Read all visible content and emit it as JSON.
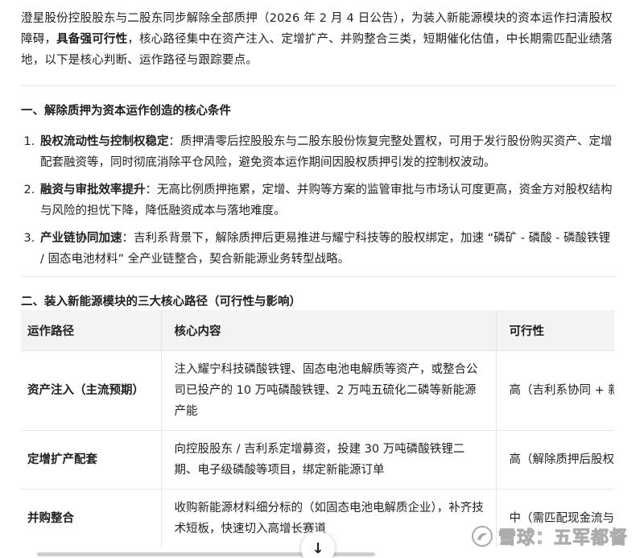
{
  "intro": {
    "text_a": "澄星股份控股股东与二股东同步解除全部质押（2026 年 2 月 4 日公告），为装入新能源模块的资本运作扫清股权障碍，",
    "bold": "具备强可行性",
    "text_b": "，核心路径集中在资产注入、定增扩产、并购整合三类，短期催化估值，中长期需匹配业绩落地，以下是核心判断、运作路径与跟踪要点。"
  },
  "section1": {
    "title": "一、解除质押为资本运作创造的核心条件",
    "items": [
      {
        "bold": "股权流动性与控制权稳定",
        "text": "：质押清零后控股股东与二股东股份恢复完整处置权，可用于发行股份购买资产、定增配套融资等，同时彻底消除平仓风险，避免资本运作期间因股权质押引发的控制权波动。"
      },
      {
        "bold": "融资与审批效率提升",
        "text": "：无高比例质押拖累，定增、并购等方案的监管审批与市场认可度更高，资金方对股权结构与风险的担忧下降，降低融资成本与落地难度。"
      },
      {
        "bold": "产业链协同加速",
        "text": "：吉利系背景下，解除质押后更易推进与耀宁科技等的股权绑定，加速 “磷矿 - 磷酸 - 磷酸铁锂 / 固态电池材料” 全产业链整合，契合新能源业务转型战略。"
      }
    ]
  },
  "section2": {
    "title": "二、装入新能源模块的三大核心路径（可行性与影响）",
    "headers": [
      "运作路径",
      "核心内容",
      "可行性"
    ],
    "rows": [
      {
        "name": "资产注入（主流预期）",
        "content": "注入耀宁科技磷酸铁锂、固态电池电解质等资产，或整合公司已投产的 10 万吨磷酸铁锂、2 万吨五硫化二磷等新能源产能",
        "feasibility": "高（吉利系协同 + 新"
      },
      {
        "name": "定增扩产配套",
        "content": "向控股股东 / 吉利系定增募资，投建 30 万吨磷酸铁锂二期、电子级磷酸等项目，绑定新能源订单",
        "feasibility": "高（解除质押后股权"
      },
      {
        "name": "并购整合",
        "content": "收购新能源材料细分标的（如固态电池电解质企业），补齐技术短板，快速切入高增长赛道",
        "feasibility": "中（需匹配现金流与"
      }
    ]
  },
  "controls": {
    "scroll_down_glyph": "↓"
  },
  "watermark": {
    "text": "雪球：五军都督"
  }
}
